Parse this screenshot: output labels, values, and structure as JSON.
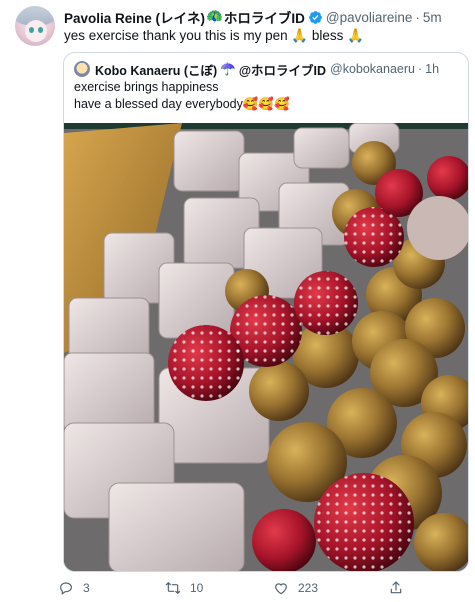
{
  "tweet": {
    "author_name": "Pavolia Reine (レイネ)",
    "author_suffix": "ホロライブID",
    "handle": "@pavoliareine",
    "separator": "·",
    "time": "5m",
    "text": "yes exercise thank you this is my pen 🙏 bless 🙏"
  },
  "quoted": {
    "author_name": "Kobo Kanaeru (こぼ)",
    "author_suffix": "@ホロライブID",
    "handle": "@kobokanaeru",
    "separator": "·",
    "time": "1h",
    "line1": "exercise brings happiness",
    "line2": "have a blessed day everybody🥰🥰🥰",
    "media_description_icon": "photo-of-sweets"
  },
  "actions": {
    "reply_count": "3",
    "retweet_count": "10",
    "like_count": "223"
  },
  "colors": {
    "verified": "#1d9bf0",
    "muted": "#536471",
    "border": "#cfd9de"
  }
}
